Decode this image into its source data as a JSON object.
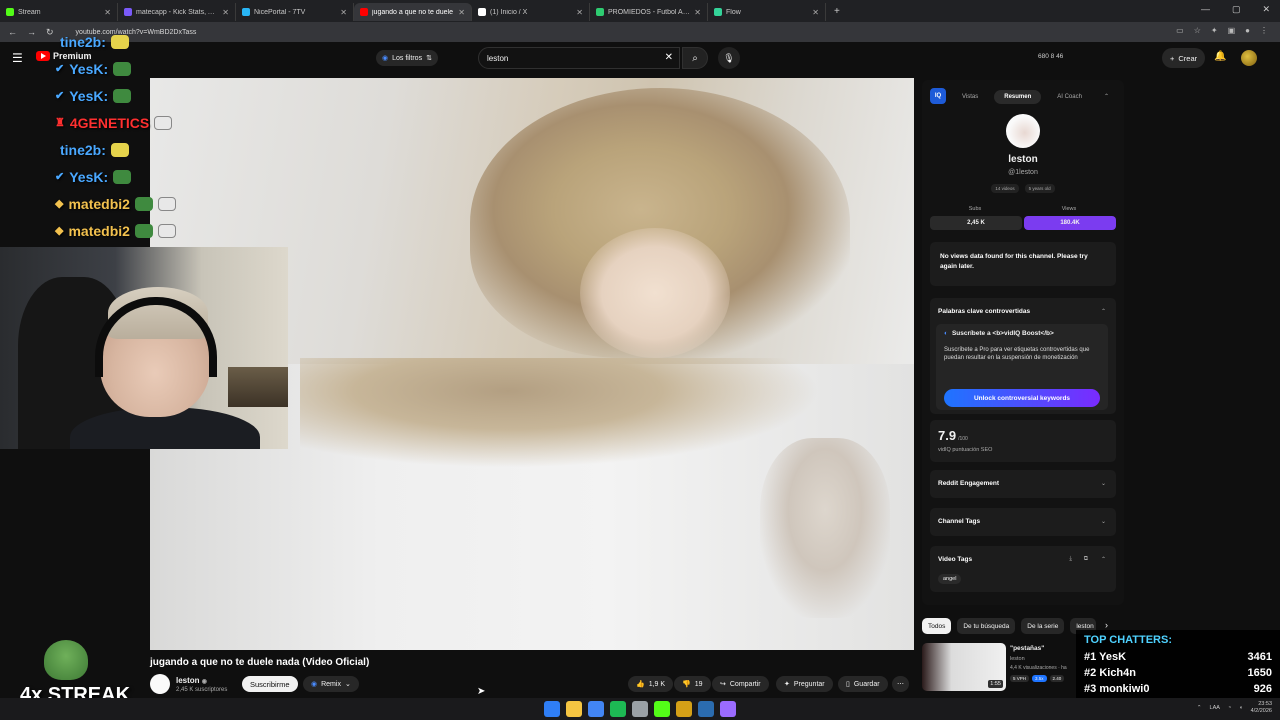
{
  "browser": {
    "tabs": [
      {
        "title": "Stream ",
        "color": "#53fc18",
        "active": false
      },
      {
        "title": "matecapp - Kick Stats, Analytic",
        "color": "#7a5af8",
        "active": false
      },
      {
        "title": "NicePortal - 7TV",
        "color": "#29b6f6",
        "active": false
      },
      {
        "title": "jugando a que no te duele",
        "color": "#ff0000",
        "active": true
      },
      {
        "title": "(1) Inicio / X",
        "color": "#ffffff",
        "active": false
      },
      {
        "title": "PROMIEDOS - Futbol Argentin",
        "color": "#2ecc71",
        "active": false
      },
      {
        "title": "Flow",
        "color": "#34d399",
        "active": false
      }
    ],
    "url": "youtube.com/watch?v=WmBD2DxTass"
  },
  "youtube": {
    "logo_text": "Premium",
    "filters_label": "Los filtros",
    "search_value": "leston",
    "header_stats": "680  8  46",
    "create_label": "Crear"
  },
  "video": {
    "title": "jugando a que no te duele nada (Video Oficial)",
    "channel": "leston",
    "subscribers": "2,45 K suscriptores",
    "subscribe_label": "Suscribirme",
    "remix_label": "Remix",
    "likes": "1,9 K",
    "dislikes": "19",
    "share_label": "Compartir",
    "ask_label": "Preguntar",
    "save_label": "Guardar"
  },
  "chat_overlay": [
    {
      "name": "tine2b:",
      "color": "#4aa8ff",
      "badge": ""
    },
    {
      "name": "YesK:",
      "color": "#4aa8ff",
      "badge": "✔"
    },
    {
      "name": "YesK:",
      "color": "#4aa8ff",
      "badge": "✔"
    },
    {
      "name": "4GENETICS",
      "color": "#ff3030",
      "badge": "♜"
    },
    {
      "name": "tine2b:",
      "color": "#4aa8ff",
      "badge": ""
    },
    {
      "name": "YesK:",
      "color": "#4aa8ff",
      "badge": "✔"
    },
    {
      "name": "matedbi2",
      "color": "#f2c14e",
      "badge": "◆"
    },
    {
      "name": "matedbi2",
      "color": "#f2c14e",
      "badge": "◆"
    },
    {
      "name": "matedbi2",
      "color": "#f2c14e",
      "badge": "◆"
    }
  ],
  "streak_text": "4x STREAK",
  "vidiq": {
    "logo": "IQ",
    "tabs": [
      "Vistas",
      "Resumen",
      "AI Coach"
    ],
    "channel_name": "leston",
    "handle": "@1leston",
    "meta": [
      "14 videos",
      "5 years old"
    ],
    "subs_label": "Subs",
    "subs_value": "2,45 K",
    "views_label": "Views",
    "views_value": "180.4K",
    "no_data_text": "No views data found for this channel. Please try again later.",
    "controversial_title": "Palabras clave controvertidas",
    "boost_title": "Suscríbete a <b>vidIQ Boost</b>",
    "boost_desc": "Suscríbete a Pro para ver etiquetas controvertidas que puedan resultar en la suspensión de monetización",
    "unlock_label": "Unlock controversial keywords",
    "seo_score": "7.9",
    "seo_outof": "/100",
    "seo_label": "vidIQ puntuación SEO",
    "reddit_label": "Reddit Engagement",
    "channel_tags_label": "Channel Tags",
    "video_tags_label": "Video Tags",
    "video_tag": "angel"
  },
  "chips": [
    "Todos",
    "De tu búsqueda",
    "De la serie",
    "leston"
  ],
  "recommended": {
    "title": "\"pestañas\"",
    "channel": "leston",
    "views": "4,4 K visualizaciones · ha",
    "duration": "1:55",
    "badges": [
      "5 VPH",
      "3.5x",
      "2.40"
    ]
  },
  "top_chatters": {
    "title": "TOP CHATTERS:",
    "rows": [
      {
        "rank": "#1",
        "name": "YesK",
        "count": "3461"
      },
      {
        "rank": "#2",
        "name": "Kich4n",
        "count": "1650"
      },
      {
        "rank": "#3",
        "name": "monkiwi0",
        "count": "926"
      }
    ]
  },
  "taskbar": {
    "lang": "LAA",
    "time": "23:53",
    "date": "4/2/2026",
    "icons": [
      "#2f7ef5",
      "#f5c542",
      "#4285f4",
      "#1db954",
      "#9aa0a6",
      "#53fc18",
      "#d4a017",
      "#2b6cb0",
      "#9b6bff"
    ]
  }
}
